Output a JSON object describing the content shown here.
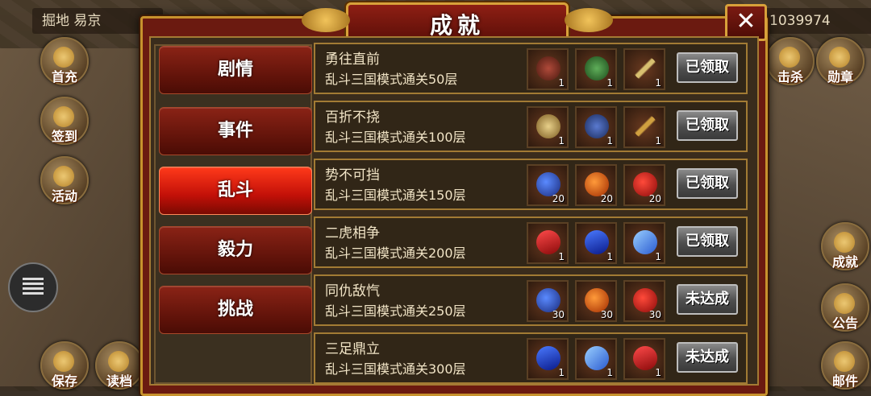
{
  "hud": {
    "location": "掘地 易京",
    "currency_value": "1039974",
    "left_buttons": [
      {
        "label": "首充",
        "icon": "gift-icon"
      },
      {
        "label": "签到",
        "icon": "sign-in-icon"
      },
      {
        "label": "活动",
        "icon": "activity-icon"
      },
      {
        "label": "保存",
        "icon": "save-icon"
      },
      {
        "label": "读档",
        "icon": "load-icon"
      }
    ],
    "right_buttons": [
      {
        "label": "击杀",
        "icon": "kill-icon"
      },
      {
        "label": "勋章",
        "icon": "medal-icon"
      },
      {
        "label": "成就",
        "icon": "achievement-icon"
      },
      {
        "label": "公告",
        "icon": "announcement-icon"
      },
      {
        "label": "邮件",
        "icon": "mail-icon"
      }
    ]
  },
  "dialog": {
    "title": "成就",
    "close_label": "✕",
    "tabs": [
      {
        "label": "剧情",
        "active": false
      },
      {
        "label": "事件",
        "active": false
      },
      {
        "label": "乱斗",
        "active": true
      },
      {
        "label": "毅力",
        "active": false
      },
      {
        "label": "挑战",
        "active": false
      }
    ],
    "achievements": [
      {
        "name": "勇往直前",
        "desc": "乱斗三国模式通关50层",
        "rewards": [
          {
            "icon": "armor-icon",
            "qty": "1"
          },
          {
            "icon": "general-icon",
            "qty": "1"
          },
          {
            "icon": "weapon-icon",
            "qty": "1"
          }
        ],
        "status": "已领取"
      },
      {
        "name": "百折不挠",
        "desc": "乱斗三国模式通关100层",
        "rewards": [
          {
            "icon": "gold-armor-icon",
            "qty": "1"
          },
          {
            "icon": "blue-general-icon",
            "qty": "1"
          },
          {
            "icon": "spear-icon",
            "qty": "1"
          }
        ],
        "status": "已领取"
      },
      {
        "name": "势不可挡",
        "desc": "乱斗三国模式通关150层",
        "rewards": [
          {
            "icon": "blue-fruit-icon",
            "qty": "20"
          },
          {
            "icon": "orange-fruit-icon",
            "qty": "20"
          },
          {
            "icon": "red-fruit-icon",
            "qty": "20"
          }
        ],
        "status": "已领取"
      },
      {
        "name": "二虎相争",
        "desc": "乱斗三国模式通关200层",
        "rewards": [
          {
            "icon": "red-book-icon",
            "qty": "1"
          },
          {
            "icon": "blue-book-icon",
            "qty": "1"
          },
          {
            "icon": "scroll-icon",
            "qty": "1"
          }
        ],
        "status": "已领取"
      },
      {
        "name": "同仇敌忾",
        "desc": "乱斗三国模式通关250层",
        "rewards": [
          {
            "icon": "blue-fruit-icon",
            "qty": "30"
          },
          {
            "icon": "orange-fruit-icon",
            "qty": "30"
          },
          {
            "icon": "red-fruit-icon",
            "qty": "30"
          }
        ],
        "status": "未达成"
      },
      {
        "name": "三足鼎立",
        "desc": "乱斗三国模式通关300层",
        "rewards": [
          {
            "icon": "blue-book-icon",
            "qty": "1"
          },
          {
            "icon": "scroll-icon",
            "qty": "1"
          },
          {
            "icon": "red-book-icon",
            "qty": "1"
          }
        ],
        "status": "未达成"
      }
    ]
  }
}
